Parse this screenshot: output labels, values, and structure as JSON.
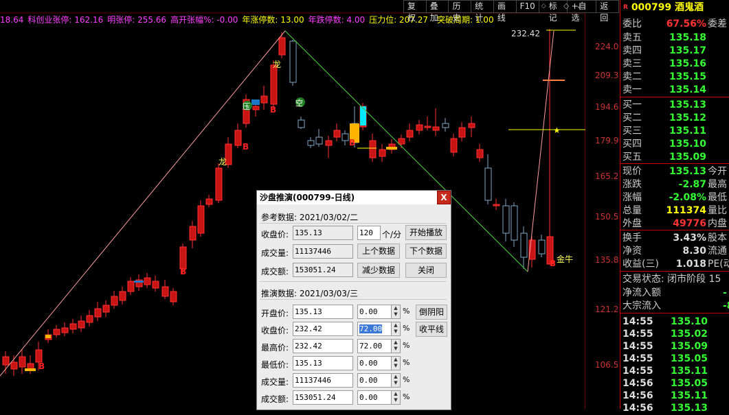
{
  "indicators": {
    "items": [
      {
        "label": "18.64",
        "color": "#ff40ff"
      },
      {
        "label": "科创业张停: 162.16",
        "color": "#ff40ff"
      },
      {
        "label": "明张停: 255.66",
        "color": "#ff40ff"
      },
      {
        "label": "高开张幅%: -0.00",
        "color": "#ff40ff"
      },
      {
        "label": "年涨停数: 13.00",
        "color": "#ffff00"
      },
      {
        "label": "年跌停数: 4.00",
        "color": "#ff40ff"
      },
      {
        "label": "压力位: 207.27",
        "color": "#ffff00"
      }
    ],
    "breakout_cycle": "突破周期: 1.00"
  },
  "toolbar": {
    "buttons": [
      "复权",
      "叠加",
      "历史",
      "统计",
      "画线",
      "F10",
      "标记",
      "+自选",
      "返回"
    ]
  },
  "chart": {
    "y_ticks": [
      "224.0",
      "209.3",
      "194.6",
      "179.9",
      "165.2",
      "150.5",
      "135.8",
      "121.2",
      "106.5"
    ],
    "max_price_label": "232.42",
    "annotations": {
      "long1": "龙",
      "long2": "龙",
      "ya": "压",
      "kong": "空",
      "jinniu": "金牛",
      "b_marker": "B"
    }
  },
  "stock": {
    "marker": "R",
    "code_name": "000799 酒鬼酒",
    "weibi_label": "委比",
    "weibi_value": "67.56%",
    "weicha_label": "委差"
  },
  "asks": [
    {
      "label": "卖五",
      "price": "135.18"
    },
    {
      "label": "卖四",
      "price": "135.17"
    },
    {
      "label": "卖三",
      "price": "135.16"
    },
    {
      "label": "卖二",
      "price": "135.15"
    },
    {
      "label": "卖一",
      "price": "135.14"
    }
  ],
  "bids": [
    {
      "label": "买一",
      "price": "135.13"
    },
    {
      "label": "买二",
      "price": "135.12"
    },
    {
      "label": "买三",
      "price": "135.11"
    },
    {
      "label": "买四",
      "price": "135.10"
    },
    {
      "label": "买五",
      "price": "135.09"
    }
  ],
  "quote": [
    {
      "label": "现价",
      "value": "135.13",
      "color": "#33ff33",
      "tail": "今开"
    },
    {
      "label": "涨跌",
      "value": "-2.87",
      "color": "#33ff33",
      "tail": "最高"
    },
    {
      "label": "涨幅",
      "value": "-2.08%",
      "color": "#33ff33",
      "tail": "最低"
    },
    {
      "label": "总量",
      "value": "111374",
      "color": "#ffff00",
      "tail": "量比"
    },
    {
      "label": "外盘",
      "value": "49776",
      "color": "#ff3333",
      "tail": "内盘"
    }
  ],
  "stats": [
    {
      "label": "换手",
      "value": "3.43%",
      "color": "#dddddd",
      "tail": "股本"
    },
    {
      "label": "净资",
      "value": "8.30",
      "color": "#dddddd",
      "tail": "流通"
    },
    {
      "label": "收益(三)",
      "value": "1.018",
      "color": "#dddddd",
      "tail": "PE(动"
    }
  ],
  "trading_status": "交易状态: 闭市阶段 15",
  "flows": [
    {
      "label": "净流入额",
      "value": "-"
    },
    {
      "label": "大宗流入",
      "value": "-8"
    }
  ],
  "ticks": [
    {
      "time": "14:55",
      "price": "135.10"
    },
    {
      "time": "14:55",
      "price": "135.02"
    },
    {
      "time": "14:55",
      "price": "135.09"
    },
    {
      "time": "14:55",
      "price": "135.05"
    },
    {
      "time": "14:55",
      "price": "135.11"
    },
    {
      "time": "14:56",
      "price": "135.05"
    },
    {
      "time": "14:56",
      "price": "135.11"
    },
    {
      "time": "14:56",
      "price": "135.13"
    }
  ],
  "dialog": {
    "title": "沙盘推演(000799-日线)",
    "close": "X",
    "ref_date": "参考数据: 2021/03/02/二",
    "ref_close_label": "收盘价:",
    "ref_close": "135.13",
    "ref_volume_label": "成交量:",
    "ref_volume": "11137446",
    "ref_amount_label": "成交额:",
    "ref_amount": "153051.24",
    "speed_value": "120",
    "speed_unit": "个/分",
    "btn_play": "开始播放",
    "btn_prev": "上个数据",
    "btn_next": "下个数据",
    "btn_reduce": "减少数据",
    "btn_close": "关闭",
    "sim_date": "推演数据: 2021/03/03/三",
    "rows": [
      {
        "label": "开盘价:",
        "value": "135.13",
        "pct": "0.00"
      },
      {
        "label": "收盘价:",
        "value": "232.42",
        "pct": "72.00"
      },
      {
        "label": "最高价:",
        "value": "232.42",
        "pct": "72.00"
      },
      {
        "label": "最低价:",
        "value": "135.13",
        "pct": "0.00"
      },
      {
        "label": "成交量:",
        "value": "11137446",
        "pct": "0.00"
      },
      {
        "label": "成交额:",
        "value": "153051.24",
        "pct": "0.00"
      }
    ],
    "pct_sign": "%",
    "btn_yinyang": "倒阴阳",
    "btn_flat": "收平线"
  }
}
